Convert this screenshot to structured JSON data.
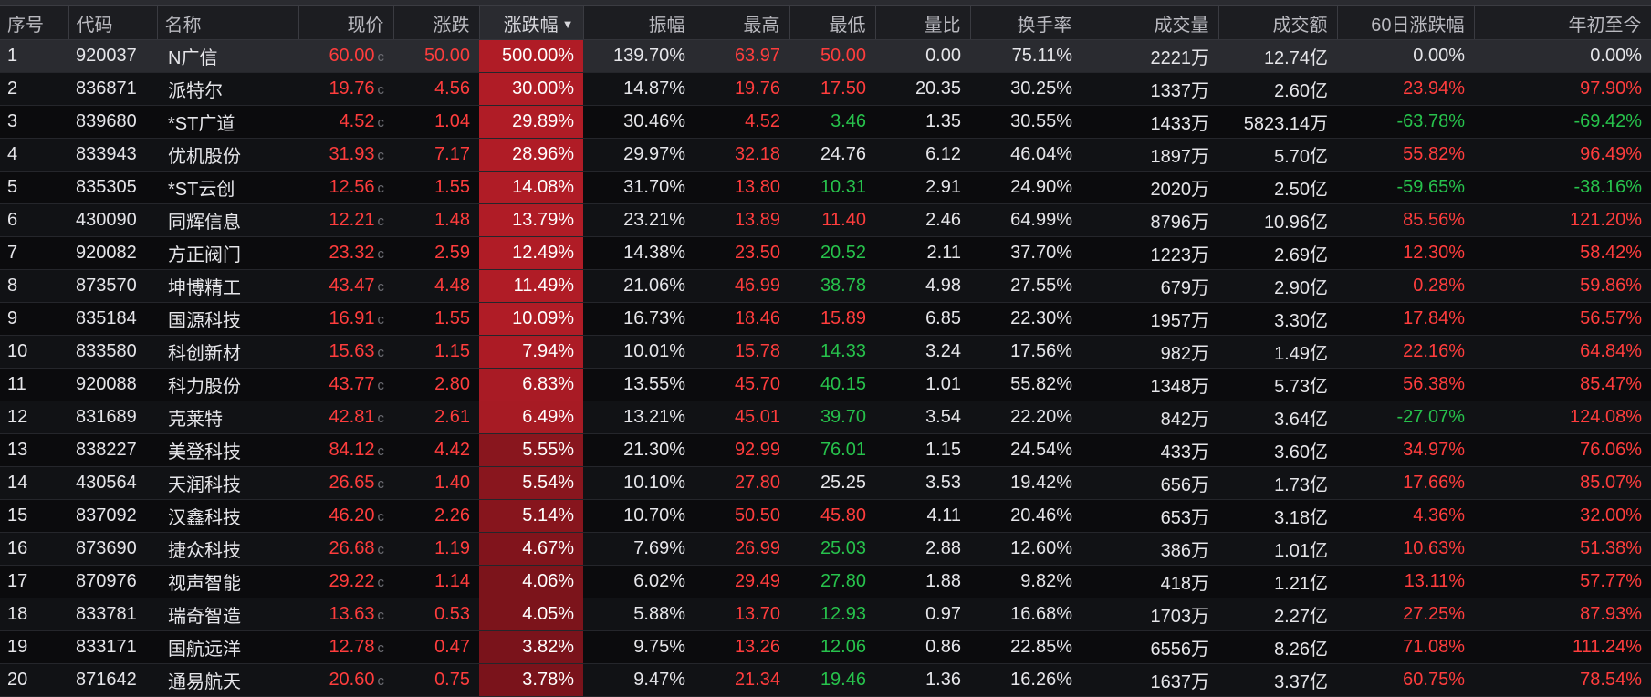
{
  "columns": [
    {
      "key": "seq",
      "label": "序号",
      "align": "left"
    },
    {
      "key": "code",
      "label": "代码",
      "align": "left"
    },
    {
      "key": "name",
      "label": "名称",
      "align": "left"
    },
    {
      "key": "price",
      "label": "现价",
      "align": "right"
    },
    {
      "key": "change",
      "label": "涨跌",
      "align": "right"
    },
    {
      "key": "change_pct",
      "label": "涨跌幅",
      "align": "right",
      "sorted": true,
      "sort_dir": "desc"
    },
    {
      "key": "amplitude",
      "label": "振幅",
      "align": "right"
    },
    {
      "key": "high",
      "label": "最高",
      "align": "right"
    },
    {
      "key": "low",
      "label": "最低",
      "align": "right"
    },
    {
      "key": "vol_ratio",
      "label": "量比",
      "align": "right"
    },
    {
      "key": "turnover",
      "label": "换手率",
      "align": "right"
    },
    {
      "key": "volume",
      "label": "成交量",
      "align": "right"
    },
    {
      "key": "amount",
      "label": "成交额",
      "align": "right"
    },
    {
      "key": "chg60",
      "label": "60日涨跌幅",
      "align": "right"
    },
    {
      "key": "ytd",
      "label": "年初至今",
      "align": "right"
    }
  ],
  "c_marker": "c",
  "colors": {
    "up": "#ff3d3d",
    "down": "#27c24c",
    "flat": "#e6e6ea",
    "pct_cell_scale": [
      "#5a0e14",
      "#b01c26"
    ]
  },
  "rows": [
    {
      "seq": "1",
      "code": "920037",
      "name": "N广信",
      "price": "60.00",
      "change": "50.00",
      "change_pct": "500.00%",
      "pct_level": 1.0,
      "amplitude": "139.70%",
      "high": "63.97",
      "low": "50.00",
      "low_dir": "up",
      "vol_ratio": "0.00",
      "turnover": "75.11%",
      "volume": "2221万",
      "amount": "12.74亿",
      "chg60": "0.00%",
      "chg60_dir": "flat",
      "ytd": "0.00%",
      "ytd_dir": "flat",
      "selected": true
    },
    {
      "seq": "2",
      "code": "836871",
      "name": "派特尔",
      "price": "19.76",
      "change": "4.56",
      "change_pct": "30.00%",
      "pct_level": 1.0,
      "amplitude": "14.87%",
      "high": "19.76",
      "low": "17.50",
      "low_dir": "up",
      "vol_ratio": "20.35",
      "turnover": "30.25%",
      "volume": "1337万",
      "amount": "2.60亿",
      "chg60": "23.94%",
      "chg60_dir": "up",
      "ytd": "97.90%",
      "ytd_dir": "up"
    },
    {
      "seq": "3",
      "code": "839680",
      "name": "*ST广道",
      "price": "4.52",
      "change": "1.04",
      "change_pct": "29.89%",
      "pct_level": 1.0,
      "amplitude": "30.46%",
      "high": "4.52",
      "low": "3.46",
      "low_dir": "down",
      "vol_ratio": "1.35",
      "turnover": "30.55%",
      "volume": "1433万",
      "amount": "5823.14万",
      "chg60": "-63.78%",
      "chg60_dir": "down",
      "ytd": "-69.42%",
      "ytd_dir": "down"
    },
    {
      "seq": "4",
      "code": "833943",
      "name": "优机股份",
      "price": "31.93",
      "change": "7.17",
      "change_pct": "28.96%",
      "pct_level": 1.0,
      "amplitude": "29.97%",
      "high": "32.18",
      "low": "24.76",
      "low_dir": "flat",
      "vol_ratio": "6.12",
      "turnover": "46.04%",
      "volume": "1897万",
      "amount": "5.70亿",
      "chg60": "55.82%",
      "chg60_dir": "up",
      "ytd": "96.49%",
      "ytd_dir": "up"
    },
    {
      "seq": "5",
      "code": "835305",
      "name": "*ST云创",
      "price": "12.56",
      "change": "1.55",
      "change_pct": "14.08%",
      "pct_level": 1.0,
      "amplitude": "31.70%",
      "high": "13.80",
      "low": "10.31",
      "low_dir": "down",
      "vol_ratio": "2.91",
      "turnover": "24.90%",
      "volume": "2020万",
      "amount": "2.50亿",
      "chg60": "-59.65%",
      "chg60_dir": "down",
      "ytd": "-38.16%",
      "ytd_dir": "down"
    },
    {
      "seq": "6",
      "code": "430090",
      "name": "同辉信息",
      "price": "12.21",
      "change": "1.48",
      "change_pct": "13.79%",
      "pct_level": 1.0,
      "amplitude": "23.21%",
      "high": "13.89",
      "low": "11.40",
      "low_dir": "up",
      "vol_ratio": "2.46",
      "turnover": "64.99%",
      "volume": "8796万",
      "amount": "10.96亿",
      "chg60": "85.56%",
      "chg60_dir": "up",
      "ytd": "121.20%",
      "ytd_dir": "up"
    },
    {
      "seq": "7",
      "code": "920082",
      "name": "方正阀门",
      "price": "23.32",
      "change": "2.59",
      "change_pct": "12.49%",
      "pct_level": 1.0,
      "amplitude": "14.38%",
      "high": "23.50",
      "low": "20.52",
      "low_dir": "down",
      "vol_ratio": "2.11",
      "turnover": "37.70%",
      "volume": "1223万",
      "amount": "2.69亿",
      "chg60": "12.30%",
      "chg60_dir": "up",
      "ytd": "58.42%",
      "ytd_dir": "up"
    },
    {
      "seq": "8",
      "code": "873570",
      "name": "坤博精工",
      "price": "43.47",
      "change": "4.48",
      "change_pct": "11.49%",
      "pct_level": 1.0,
      "amplitude": "21.06%",
      "high": "46.99",
      "low": "38.78",
      "low_dir": "down",
      "vol_ratio": "4.98",
      "turnover": "27.55%",
      "volume": "679万",
      "amount": "2.90亿",
      "chg60": "0.28%",
      "chg60_dir": "up",
      "ytd": "59.86%",
      "ytd_dir": "up"
    },
    {
      "seq": "9",
      "code": "835184",
      "name": "国源科技",
      "price": "16.91",
      "change": "1.55",
      "change_pct": "10.09%",
      "pct_level": 1.0,
      "amplitude": "16.73%",
      "high": "18.46",
      "low": "15.89",
      "low_dir": "up",
      "vol_ratio": "6.85",
      "turnover": "22.30%",
      "volume": "1957万",
      "amount": "3.30亿",
      "chg60": "17.84%",
      "chg60_dir": "up",
      "ytd": "56.57%",
      "ytd_dir": "up"
    },
    {
      "seq": "10",
      "code": "833580",
      "name": "科创新材",
      "price": "15.63",
      "change": "1.15",
      "change_pct": "7.94%",
      "pct_level": 0.95,
      "amplitude": "10.01%",
      "high": "15.78",
      "low": "14.33",
      "low_dir": "down",
      "vol_ratio": "3.24",
      "turnover": "17.56%",
      "volume": "982万",
      "amount": "1.49亿",
      "chg60": "22.16%",
      "chg60_dir": "up",
      "ytd": "64.84%",
      "ytd_dir": "up"
    },
    {
      "seq": "11",
      "code": "920088",
      "name": "科力股份",
      "price": "43.77",
      "change": "2.80",
      "change_pct": "6.83%",
      "pct_level": 0.92,
      "amplitude": "13.55%",
      "high": "45.70",
      "low": "40.15",
      "low_dir": "down",
      "vol_ratio": "1.01",
      "turnover": "55.82%",
      "volume": "1348万",
      "amount": "5.73亿",
      "chg60": "56.38%",
      "chg60_dir": "up",
      "ytd": "85.47%",
      "ytd_dir": "up"
    },
    {
      "seq": "12",
      "code": "831689",
      "name": "克莱特",
      "price": "42.81",
      "change": "2.61",
      "change_pct": "6.49%",
      "pct_level": 0.9,
      "amplitude": "13.21%",
      "high": "45.01",
      "low": "39.70",
      "low_dir": "down",
      "vol_ratio": "3.54",
      "turnover": "22.20%",
      "volume": "842万",
      "amount": "3.64亿",
      "chg60": "-27.07%",
      "chg60_dir": "down",
      "ytd": "124.08%",
      "ytd_dir": "up"
    },
    {
      "seq": "13",
      "code": "838227",
      "name": "美登科技",
      "price": "84.12",
      "change": "4.42",
      "change_pct": "5.55%",
      "pct_level": 0.55,
      "amplitude": "21.30%",
      "high": "92.99",
      "low": "76.01",
      "low_dir": "down",
      "vol_ratio": "1.15",
      "turnover": "24.54%",
      "volume": "433万",
      "amount": "3.60亿",
      "chg60": "34.97%",
      "chg60_dir": "up",
      "ytd": "76.06%",
      "ytd_dir": "up"
    },
    {
      "seq": "14",
      "code": "430564",
      "name": "天润科技",
      "price": "26.65",
      "change": "1.40",
      "change_pct": "5.54%",
      "pct_level": 0.55,
      "amplitude": "10.10%",
      "high": "27.80",
      "low": "25.25",
      "low_dir": "flat",
      "vol_ratio": "3.53",
      "turnover": "19.42%",
      "volume": "656万",
      "amount": "1.73亿",
      "chg60": "17.66%",
      "chg60_dir": "up",
      "ytd": "85.07%",
      "ytd_dir": "up"
    },
    {
      "seq": "15",
      "code": "837092",
      "name": "汉鑫科技",
      "price": "46.20",
      "change": "2.26",
      "change_pct": "5.14%",
      "pct_level": 0.52,
      "amplitude": "10.70%",
      "high": "50.50",
      "low": "45.80",
      "low_dir": "up",
      "vol_ratio": "4.11",
      "turnover": "20.46%",
      "volume": "653万",
      "amount": "3.18亿",
      "chg60": "4.36%",
      "chg60_dir": "up",
      "ytd": "32.00%",
      "ytd_dir": "up"
    },
    {
      "seq": "16",
      "code": "873690",
      "name": "捷众科技",
      "price": "26.68",
      "change": "1.19",
      "change_pct": "4.67%",
      "pct_level": 0.45,
      "amplitude": "7.69%",
      "high": "26.99",
      "low": "25.03",
      "low_dir": "down",
      "vol_ratio": "2.88",
      "turnover": "12.60%",
      "volume": "386万",
      "amount": "1.01亿",
      "chg60": "10.63%",
      "chg60_dir": "up",
      "ytd": "51.38%",
      "ytd_dir": "up"
    },
    {
      "seq": "17",
      "code": "870976",
      "name": "视声智能",
      "price": "29.22",
      "change": "1.14",
      "change_pct": "4.06%",
      "pct_level": 0.4,
      "amplitude": "6.02%",
      "high": "29.49",
      "low": "27.80",
      "low_dir": "down",
      "vol_ratio": "1.88",
      "turnover": "9.82%",
      "volume": "418万",
      "amount": "1.21亿",
      "chg60": "13.11%",
      "chg60_dir": "up",
      "ytd": "57.77%",
      "ytd_dir": "up"
    },
    {
      "seq": "18",
      "code": "833781",
      "name": "瑞奇智造",
      "price": "13.63",
      "change": "0.53",
      "change_pct": "4.05%",
      "pct_level": 0.4,
      "amplitude": "5.88%",
      "high": "13.70",
      "low": "12.93",
      "low_dir": "down",
      "vol_ratio": "0.97",
      "turnover": "16.68%",
      "volume": "1703万",
      "amount": "2.27亿",
      "chg60": "27.25%",
      "chg60_dir": "up",
      "ytd": "87.93%",
      "ytd_dir": "up"
    },
    {
      "seq": "19",
      "code": "833171",
      "name": "国航远洋",
      "price": "12.78",
      "change": "0.47",
      "change_pct": "3.82%",
      "pct_level": 0.37,
      "amplitude": "9.75%",
      "high": "13.26",
      "low": "12.06",
      "low_dir": "down",
      "vol_ratio": "0.86",
      "turnover": "22.85%",
      "volume": "6556万",
      "amount": "8.26亿",
      "chg60": "71.08%",
      "chg60_dir": "up",
      "ytd": "111.24%",
      "ytd_dir": "up"
    },
    {
      "seq": "20",
      "code": "871642",
      "name": "通易航天",
      "price": "20.60",
      "change": "0.75",
      "change_pct": "3.78%",
      "pct_level": 0.37,
      "amplitude": "9.47%",
      "high": "21.34",
      "low": "19.46",
      "low_dir": "down",
      "vol_ratio": "1.36",
      "turnover": "16.26%",
      "volume": "1637万",
      "amount": "3.37亿",
      "chg60": "60.75%",
      "chg60_dir": "up",
      "ytd": "78.54%",
      "ytd_dir": "up"
    }
  ]
}
